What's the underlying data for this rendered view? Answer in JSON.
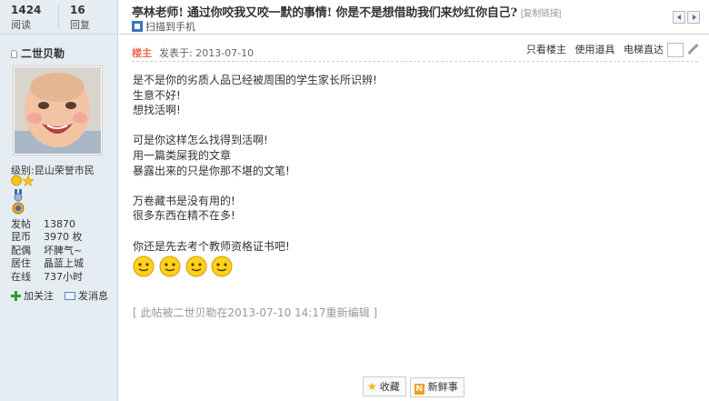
{
  "stats": {
    "views_num": "1424",
    "views_label": "阅读",
    "replies_num": "16",
    "replies_label": "回复"
  },
  "user": {
    "name": "二世贝勒",
    "level_label": "级别:",
    "level_value": "昆山荣誉市民",
    "info": [
      {
        "key": "发帖",
        "value": "13870"
      },
      {
        "key": "昆币",
        "value": "3970 枚"
      },
      {
        "key": "配偶",
        "value": "坏脾气~"
      },
      {
        "key": "居住",
        "value": "晶蓝上城"
      },
      {
        "key": "在线",
        "value": "737小时"
      }
    ],
    "follow_label": "加关注",
    "message_label": "发消息"
  },
  "header": {
    "title": "亭林老师! 通过你咬我又咬一默的事情! 你是不是想借助我们来炒红你自己?",
    "copy_link": "[复制链接]",
    "scan_label": "扫描到手机"
  },
  "post": {
    "owner_badge": "楼主",
    "posted_at": "发表于: 2013-07-10",
    "only_owner": "只看楼主",
    "use_tool": "使用道具",
    "elevator": "电梯直达",
    "lines": [
      "是不是你的劣质人品已经被周围的学生家长所识辨!",
      "生意不好!",
      "想找活啊!",
      "",
      "可是你这样怎么找得到活啊!",
      "用一篇类屎我的文章",
      "暴露出来的只是你那不堪的文笔!",
      "",
      "万卷藏书是没有用的!",
      "很多东西在精不在多!",
      "",
      "你还是先去考个教师资格证书吧!"
    ],
    "edit_note": "[ 此帖被二世贝勒在2013-07-10 14:17重新编辑 ]"
  },
  "buttons": {
    "favorite": "收藏",
    "new_post": "新鲜事"
  },
  "colors": {
    "sidebar_bg": "#e5edf2",
    "border": "#c2d5e3",
    "owner_badge": "#f26c4f"
  }
}
